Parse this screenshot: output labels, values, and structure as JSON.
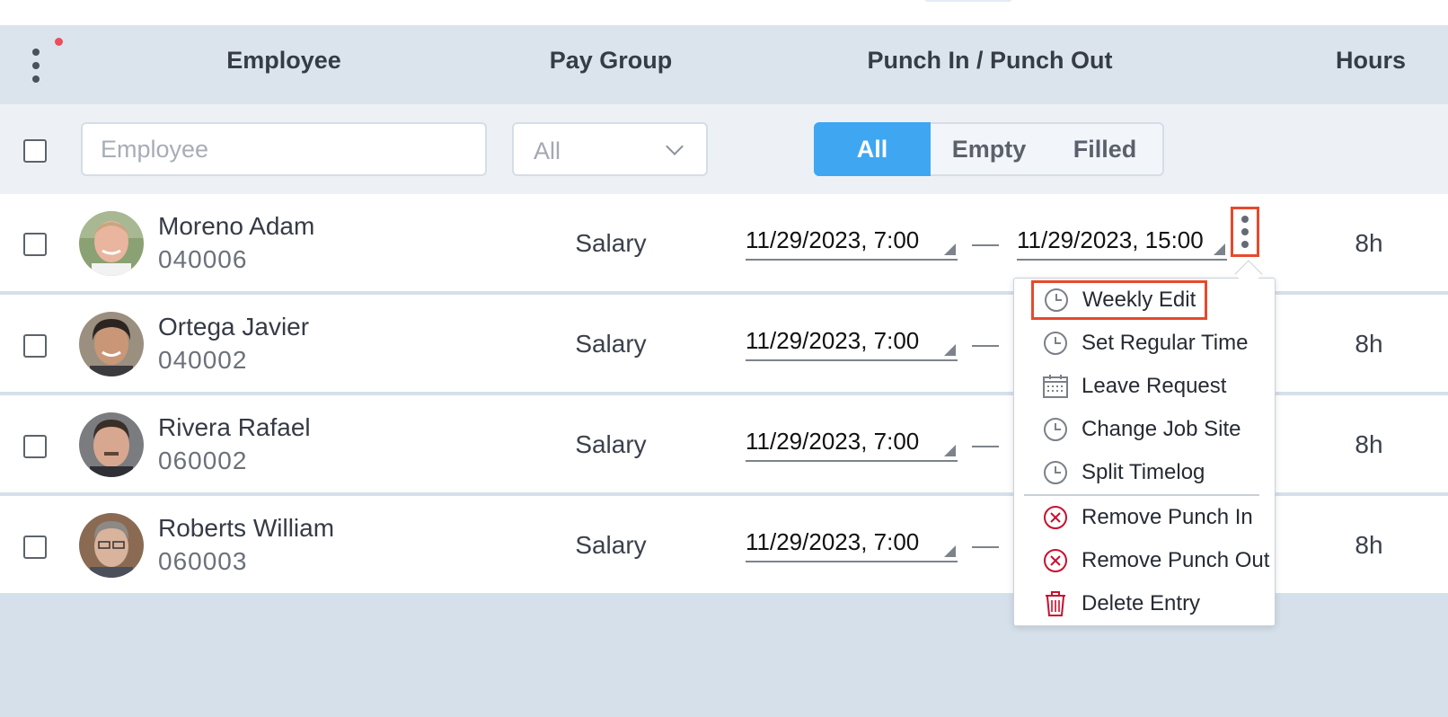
{
  "header": {
    "columns": {
      "employee": "Employee",
      "pay_group": "Pay Group",
      "punch": "Punch In / Punch Out",
      "hours": "Hours"
    }
  },
  "filters": {
    "employee_placeholder": "Employee",
    "pay_group_value": "All",
    "punch_segments": [
      "All",
      "Empty",
      "Filled"
    ],
    "punch_selected": "All"
  },
  "rows": [
    {
      "name": "Moreno Adam",
      "id": "040006",
      "pay_group": "Salary",
      "punch_in": "11/29/2023, 7:00",
      "punch_out": "11/29/2023, 15:00",
      "hours": "8h"
    },
    {
      "name": "Ortega Javier",
      "id": "040002",
      "pay_group": "Salary",
      "punch_in": "11/29/2023, 7:00",
      "hours": "8h"
    },
    {
      "name": "Rivera Rafael",
      "id": "060002",
      "pay_group": "Salary",
      "punch_in": "11/29/2023, 7:00",
      "hours": "8h"
    },
    {
      "name": "Roberts William",
      "id": "060003",
      "pay_group": "Salary",
      "punch_in": "11/29/2023, 7:00",
      "hours": "8h"
    }
  ],
  "context_menu": {
    "items": [
      {
        "label": "Weekly Edit",
        "icon": "clock-icon"
      },
      {
        "label": "Set Regular Time",
        "icon": "clock-icon"
      },
      {
        "label": "Leave Request",
        "icon": "calendar-icon"
      },
      {
        "label": "Change Job Site",
        "icon": "clock-icon"
      },
      {
        "label": "Split Timelog",
        "icon": "clock-icon"
      },
      {
        "label": "Remove Punch In",
        "icon": "remove-circle-icon"
      },
      {
        "label": "Remove Punch Out",
        "icon": "remove-circle-icon"
      },
      {
        "label": "Delete Entry",
        "icon": "trash-icon"
      }
    ]
  },
  "colors": {
    "accent": "#3fa7f2",
    "highlight": "#e64a2c",
    "danger": "#c8102e",
    "notification": "#ef4d5c"
  }
}
